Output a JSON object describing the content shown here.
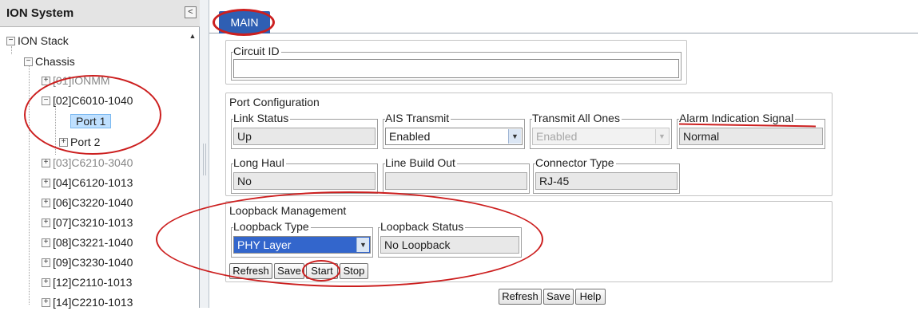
{
  "tree": {
    "title": "ION System",
    "collapse_glyph": "<",
    "nodes": [
      {
        "label": "ION Stack"
      },
      {
        "label": "Chassis"
      },
      {
        "label": "[01]IONMM"
      },
      {
        "label": "[02]C6010-1040"
      },
      {
        "label": "Port 1"
      },
      {
        "label": "Port 2"
      },
      {
        "label": "[03]C6210-3040"
      },
      {
        "label": "[04]C6120-1013"
      },
      {
        "label": "[06]C3220-1040"
      },
      {
        "label": "[07]C3210-1013"
      },
      {
        "label": "[08]C3221-1040"
      },
      {
        "label": "[09]C3230-1040"
      },
      {
        "label": "[12]C2110-1013"
      },
      {
        "label": "[14]C2210-1013"
      }
    ]
  },
  "tabs": [
    {
      "label": "MAIN",
      "active": true
    }
  ],
  "circuit": {
    "legend": "Circuit ID",
    "value": ""
  },
  "port_config": {
    "legend": "Port Configuration",
    "link_status": {
      "label": "Link Status",
      "value": "Up"
    },
    "ais_transmit": {
      "label": "AIS Transmit",
      "value": "Enabled"
    },
    "transmit_all_ones": {
      "label": "Transmit All Ones",
      "value": "Enabled"
    },
    "alarm_indication": {
      "label": "Alarm Indication Signal",
      "value": "Normal"
    },
    "long_haul": {
      "label": "Long Haul",
      "value": "No"
    },
    "line_build_out": {
      "label": "Line Build Out",
      "value": ""
    },
    "connector_type": {
      "label": "Connector Type",
      "value": "RJ-45"
    }
  },
  "loopback": {
    "legend": "Loopback Management",
    "type": {
      "label": "Loopback Type",
      "value": "PHY Layer"
    },
    "status": {
      "label": "Loopback Status",
      "value": "No Loopback"
    },
    "buttons": {
      "refresh": "Refresh",
      "save": "Save",
      "start": "Start",
      "stop": "Stop"
    }
  },
  "footer_buttons": {
    "refresh": "Refresh",
    "save": "Save",
    "help": "Help"
  },
  "colors": {
    "tab_active": "#2f5fb3",
    "annotation": "#cc1f1f",
    "selection": "#bfe0ff"
  }
}
